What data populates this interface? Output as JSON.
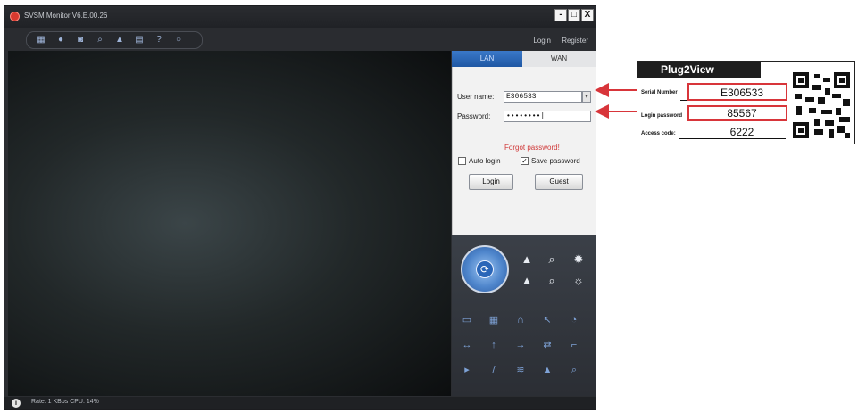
{
  "window": {
    "title": "SVSM Monitor  V6.E.00.26",
    "minimize": "-",
    "maximize": "□",
    "close": "X"
  },
  "toolbar": {
    "login_link": "Login",
    "register_link": "Register"
  },
  "tabs": {
    "lan": "LAN",
    "wan": "WAN"
  },
  "login": {
    "username_label": "User name:",
    "username_value": "E306533",
    "password_label": "Password:",
    "password_value": "••••••••|",
    "forgot": "Forgot password!",
    "auto_login": "Auto login",
    "save_password": "Save password",
    "save_password_checked": "✓",
    "login_button": "Login",
    "guest_button": "Guest"
  },
  "status": {
    "text": "Rate: 1 KBps  CPU: 14%"
  },
  "card": {
    "title": "Plug2View",
    "serial_label": "Serial Number",
    "serial_value": "E306533",
    "password_label": "Login password",
    "password_value": "85567",
    "access_label": "Access code:",
    "access_value": "6222"
  },
  "colors": {
    "accent_blue": "#2a66b8",
    "highlight_red": "#d8353a",
    "link_red": "#d03a3a"
  }
}
